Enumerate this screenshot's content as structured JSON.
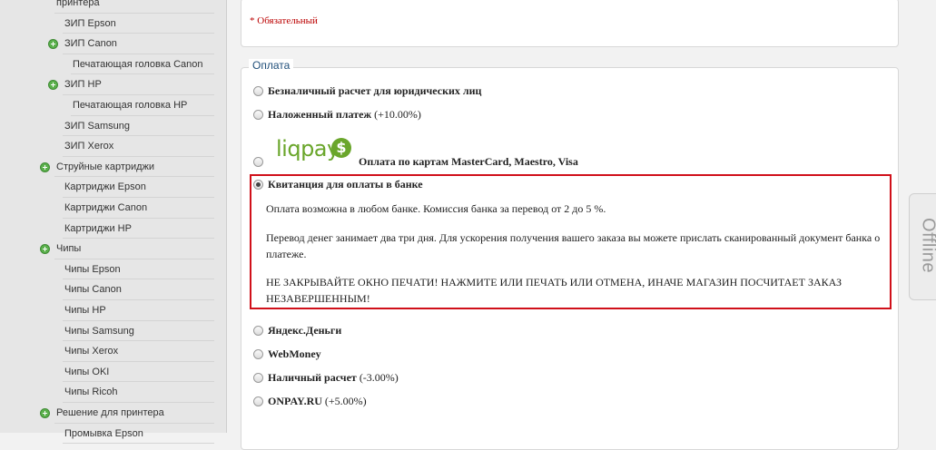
{
  "sidebar": {
    "items": [
      {
        "label": "принтера",
        "level": 1,
        "plus": false
      },
      {
        "label": "ЗИП Epson",
        "level": 2,
        "plus": false
      },
      {
        "label": "ЗИП Canon",
        "level": 2,
        "plus": true
      },
      {
        "label": "Печатающая головка Canon",
        "level": 3,
        "plus": false
      },
      {
        "label": "ЗИП HP",
        "level": 2,
        "plus": true
      },
      {
        "label": "Печатающая головка HP",
        "level": 3,
        "plus": false
      },
      {
        "label": "ЗИП Samsung",
        "level": 2,
        "plus": false
      },
      {
        "label": "ЗИП Xerox",
        "level": 2,
        "plus": false
      },
      {
        "label": "Струйные картриджи",
        "level": 1,
        "plus": true
      },
      {
        "label": "Картриджи Epson",
        "level": 2,
        "plus": false
      },
      {
        "label": "Картриджи Canon",
        "level": 2,
        "plus": false
      },
      {
        "label": "Картриджи HP",
        "level": 2,
        "plus": false
      },
      {
        "label": "Чипы",
        "level": 1,
        "plus": true
      },
      {
        "label": "Чипы Epson",
        "level": 2,
        "plus": false
      },
      {
        "label": "Чипы Canon",
        "level": 2,
        "plus": false
      },
      {
        "label": "Чипы HP",
        "level": 2,
        "plus": false
      },
      {
        "label": "Чипы Samsung",
        "level": 2,
        "plus": false
      },
      {
        "label": "Чипы Xerox",
        "level": 2,
        "plus": false
      },
      {
        "label": "Чипы OKI",
        "level": 2,
        "plus": false
      },
      {
        "label": "Чипы Ricoh",
        "level": 2,
        "plus": false
      },
      {
        "label": "Решение для принтера",
        "level": 1,
        "plus": true
      },
      {
        "label": "Промывка Epson",
        "level": 2,
        "plus": false
      }
    ]
  },
  "form": {
    "required_note": "* Обязательный"
  },
  "payment": {
    "legend": "Оплата",
    "options": [
      {
        "name": "Безналичный расчет для юридических лиц",
        "extra": "",
        "checked": false
      },
      {
        "name": "Наложенный платеж",
        "extra": "(+10.00%)",
        "checked": false
      },
      {
        "name": "Оплата по картам MasterCard, Maestro, Visa",
        "extra": "",
        "checked": false,
        "logo": "liqpay"
      },
      {
        "name": "Квитанция для оплаты в банке",
        "extra": "",
        "checked": true
      },
      {
        "name": "Яндекс.Деньги",
        "extra": "",
        "checked": false
      },
      {
        "name": "WebMoney",
        "extra": "",
        "checked": false
      },
      {
        "name": "Наличный расчет",
        "extra": "(-3.00%)",
        "checked": false
      },
      {
        "name": "ONPAY.RU",
        "extra": "(+5.00%)",
        "checked": false
      }
    ],
    "logo_text": "liqpay",
    "logo_coin": "$",
    "description": [
      "Оплата возможна в любом банке. Комиссия банка за перевод от 2 до 5 %.",
      "Перевод денег занимает два три дня. Для ускорения получения вашего заказа вы можете прислать сканированный документ банка о платеже.",
      "НЕ ЗАКРЫВАЙТЕ ОКНО ПЕЧАТИ! НАЖМИТЕ ИЛИ ПЕЧАТЬ ИЛИ ОТМЕНА, ИНАЧЕ МАГАЗИН ПОСЧИТАЕТ ЗАКАЗ НЕЗАВЕРШЕННЫМ!"
    ],
    "highlight_color": "#d0101a"
  },
  "offline_tab": "Offline"
}
